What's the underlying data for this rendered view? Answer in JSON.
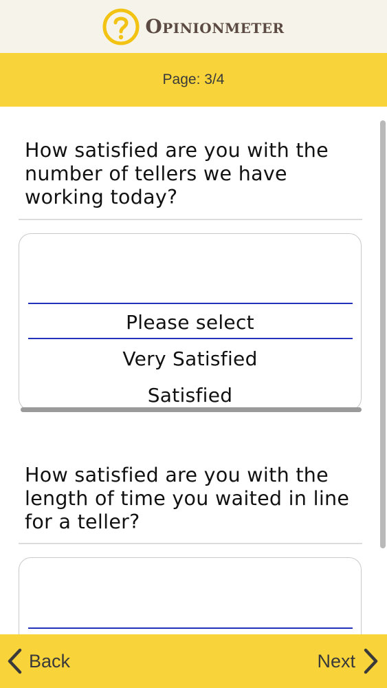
{
  "header": {
    "brand": "Opinionmeter",
    "logo_icon": "question-mark-circle-icon"
  },
  "page_indicator": "Page: 3/4",
  "questions": [
    {
      "text": "How satisfied are you with the number of tellers we have working today?",
      "picker": {
        "options": [
          "Please select",
          "Very Satisfied",
          "Satisfied"
        ],
        "selected": "Please select"
      }
    },
    {
      "text": "How satisfied are you with the length of time you waited in line for a teller?",
      "picker": {
        "options": []
      }
    }
  ],
  "footer": {
    "back_label": "Back",
    "next_label": "Next"
  },
  "colors": {
    "accent": "#F8D43A",
    "header_bg": "#F6F3EA",
    "selection_line": "#2233BB",
    "brand_text": "#5A4A43"
  }
}
